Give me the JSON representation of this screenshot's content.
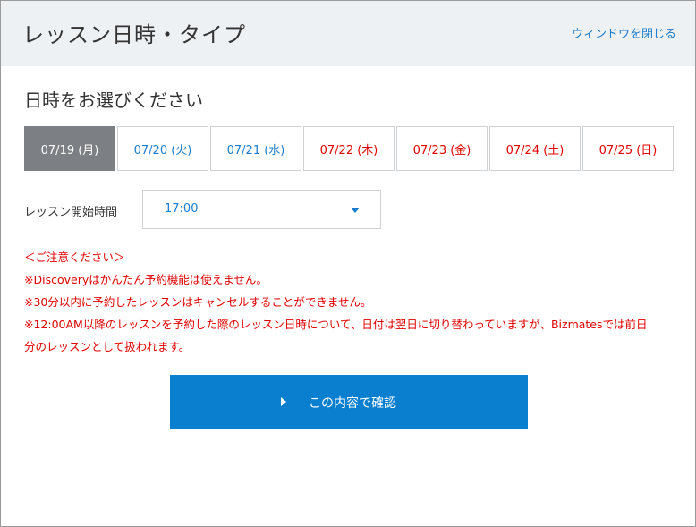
{
  "header": {
    "title": "レッスン日時・タイプ",
    "close_label": "ウィンドウを閉じる"
  },
  "section_title": "日時をお選びください",
  "dates": [
    {
      "label": "07/19 (月)",
      "state": "selected"
    },
    {
      "label": "07/20 (火)",
      "state": "weekday"
    },
    {
      "label": "07/21 (水)",
      "state": "weekday"
    },
    {
      "label": "07/22 (木)",
      "state": "weekend"
    },
    {
      "label": "07/23 (金)",
      "state": "weekend"
    },
    {
      "label": "07/24 (土)",
      "state": "weekend"
    },
    {
      "label": "07/25 (日)",
      "state": "weekend"
    }
  ],
  "time": {
    "label": "レッスン開始時間",
    "value": "17:00"
  },
  "notes": [
    "＜ご注意ください＞",
    "※Discoveryはかんたん予約機能は使えません。",
    "※30分以内に予約したレッスンはキャンセルすることができません。",
    "※12:00AM以降のレッスンを予約した際のレッスン日時について、日付は翌日に切り替わっていますが、Bizmatesでは前日",
    "分のレッスンとして扱われます。"
  ],
  "confirm": {
    "label": "この内容で確認"
  },
  "colors": {
    "accent": "#1a7ccc",
    "button": "#0a7fcf",
    "warning": "#e00000",
    "selected_tab": "#7c7f83",
    "header_bg": "#eef1f4"
  }
}
